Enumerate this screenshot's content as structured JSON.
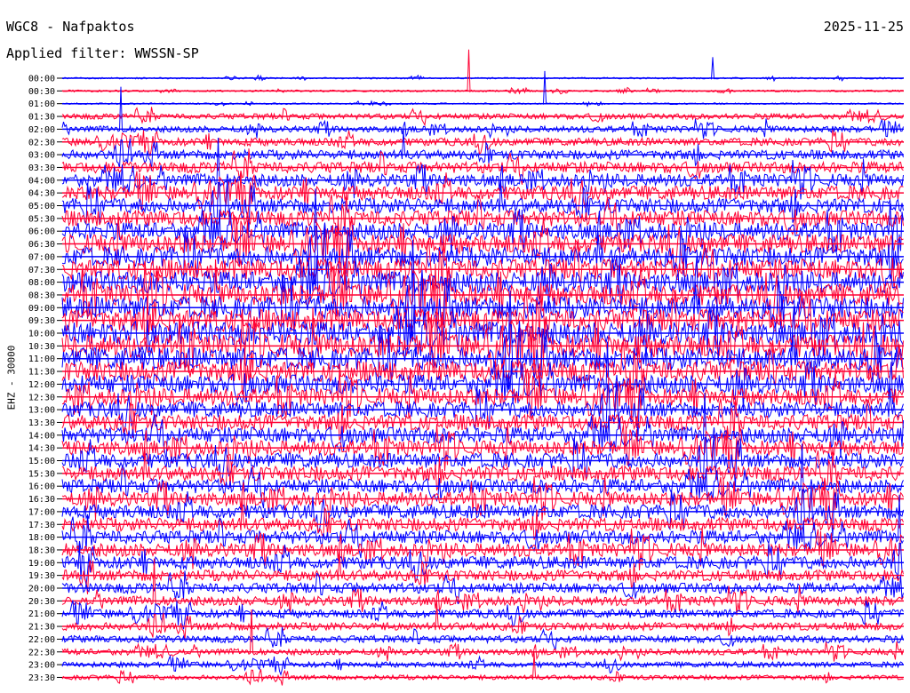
{
  "header": {
    "title": "WGC8 - Nafpaktos",
    "date": "2025-11-25",
    "filter": "Applied filter: WWSSN-SP"
  },
  "chart_data": {
    "type": "line",
    "channel_label": "EHZ - 30000",
    "row_labels": [
      "00:00",
      "00:30",
      "01:00",
      "01:30",
      "02:00",
      "02:30",
      "03:00",
      "03:30",
      "04:00",
      "04:30",
      "05:00",
      "05:30",
      "06:00",
      "06:30",
      "07:00",
      "07:30",
      "08:00",
      "08:30",
      "09:00",
      "09:30",
      "10:00",
      "10:30",
      "11:00",
      "11:30",
      "12:00",
      "12:30",
      "13:00",
      "13:30",
      "14:00",
      "14:30",
      "15:00",
      "15:30",
      "16:00",
      "16:30",
      "17:00",
      "17:30",
      "18:00",
      "18:30",
      "19:00",
      "19:30",
      "20:00",
      "20:30",
      "21:00",
      "21:30",
      "22:00",
      "22:30",
      "23:00",
      "23:30"
    ],
    "series_colors": [
      "#0000ff",
      "#ff0033"
    ],
    "relative_amplitude": [
      0.1,
      0.12,
      0.1,
      0.35,
      0.4,
      0.5,
      0.6,
      0.7,
      0.8,
      0.9,
      0.95,
      1.0,
      1.1,
      1.2,
      1.25,
      1.3,
      1.35,
      1.35,
      1.4,
      1.4,
      1.45,
      1.45,
      1.4,
      1.3,
      1.2,
      1.1,
      1.0,
      1.0,
      1.0,
      0.95,
      0.95,
      0.95,
      0.9,
      0.9,
      0.9,
      0.85,
      0.85,
      0.85,
      0.8,
      0.7,
      0.65,
      0.6,
      0.55,
      0.5,
      0.45,
      0.4,
      0.35,
      0.3
    ]
  }
}
